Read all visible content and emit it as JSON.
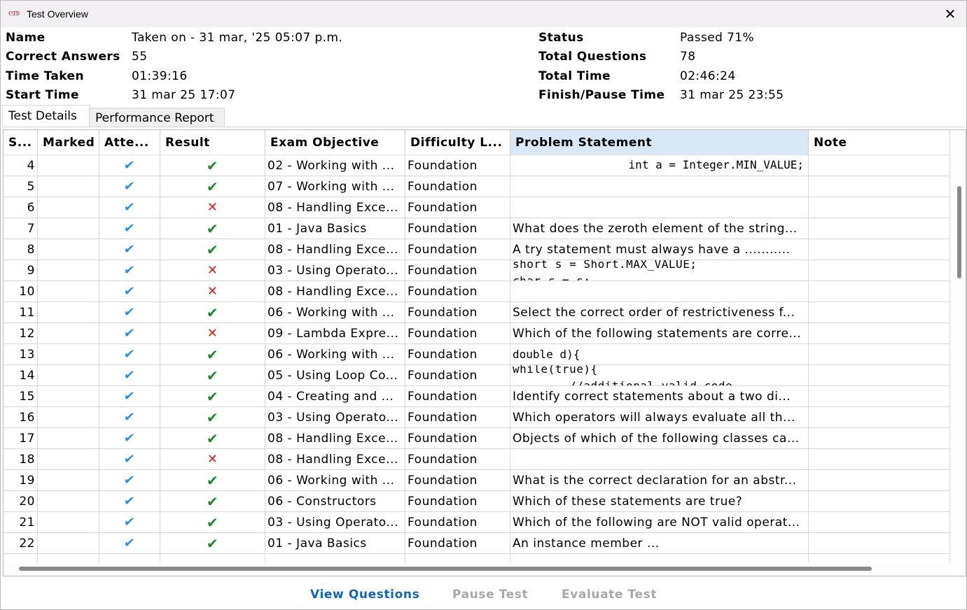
{
  "window": {
    "title": "Test Overview",
    "app_icon_text": "℮ᴛs",
    "close_glyph": "✕"
  },
  "summary": {
    "name_label": "Name",
    "name_value": "Taken on - 31 mar, '25 05:07 p.m.",
    "correct_label": "Correct Answers",
    "correct_value": "55",
    "time_taken_label": "Time Taken",
    "time_taken_value": "01:39:16",
    "start_label": "Start Time",
    "start_value": "31 mar 25 17:07",
    "status_label": "Status",
    "status_value": "Passed 71%",
    "total_q_label": "Total Questions",
    "total_q_value": "78",
    "total_time_label": "Total Time",
    "total_time_value": "02:46:24",
    "finish_label": "Finish/Pause Time",
    "finish_value": "31 mar 25 23:55"
  },
  "tabs": {
    "details": "Test Details",
    "report": "Performance Report"
  },
  "table": {
    "headers": [
      "S...",
      "Marked",
      "Atte...",
      "Result",
      "Exam Objective",
      "Difficulty L...",
      "Problem Statement",
      "Note"
    ],
    "rows": [
      {
        "sn": "4",
        "result": "ok",
        "objective": "02 - Working with ...",
        "difficulty": "Foundation",
        "problem": "int a = Integer.MIN_VALUE;",
        "ptype": "code-right"
      },
      {
        "sn": "5",
        "result": "ok",
        "objective": "07 - Working with ...",
        "difficulty": "Foundation",
        "problem": "",
        "ptype": "text"
      },
      {
        "sn": "6",
        "result": "bad",
        "objective": "08 - Handling Exce...",
        "difficulty": "Foundation",
        "problem": "",
        "ptype": "text"
      },
      {
        "sn": "7",
        "result": "ok",
        "objective": "01 - Java Basics",
        "difficulty": "Foundation",
        "problem": "What does the zeroth element of the string...",
        "ptype": "text"
      },
      {
        "sn": "8",
        "result": "ok",
        "objective": "08 - Handling Exce...",
        "difficulty": "Foundation",
        "problem": "A try statement must always have a ...........",
        "ptype": "text"
      },
      {
        "sn": "9",
        "result": "bad",
        "objective": "03 - Using Operato...",
        "difficulty": "Foundation",
        "problem": "short s = Short.MAX_VALUE;",
        "problem2": "char c = s;",
        "ptype": "code2"
      },
      {
        "sn": "10",
        "result": "bad",
        "objective": "08 - Handling Exce...",
        "difficulty": "Foundation",
        "problem": "",
        "ptype": "text"
      },
      {
        "sn": "11",
        "result": "ok",
        "objective": "06 - Working with ...",
        "difficulty": "Foundation",
        "problem": "Select the correct order of restrictiveness f...",
        "ptype": "text"
      },
      {
        "sn": "12",
        "result": "bad",
        "objective": "09 - Lambda Expre...",
        "difficulty": "Foundation",
        "problem": "Which of the following statements are corre...",
        "ptype": "text"
      },
      {
        "sn": "13",
        "result": "ok",
        "objective": "06 - Working with ...",
        "difficulty": "Foundation",
        "problem": "double d){",
        "ptype": "code-left"
      },
      {
        "sn": "14",
        "result": "ok",
        "objective": "05 - Using Loop Co...",
        "difficulty": "Foundation",
        "problem": "while(true){",
        "problem2": "        //additional valid code",
        "ptype": "code2"
      },
      {
        "sn": "15",
        "result": "ok",
        "objective": "04 - Creating and ...",
        "difficulty": "Foundation",
        "problem": "Identify correct statements about a two di...",
        "ptype": "text"
      },
      {
        "sn": "16",
        "result": "ok",
        "objective": "03 - Using Operato...",
        "difficulty": "Foundation",
        "problem": "Which operators will always evaluate all th...",
        "ptype": "text"
      },
      {
        "sn": "17",
        "result": "ok",
        "objective": "08 - Handling Exce...",
        "difficulty": "Foundation",
        "problem": "Objects of which of the following classes ca...",
        "ptype": "text"
      },
      {
        "sn": "18",
        "result": "bad",
        "objective": "08 - Handling Exce...",
        "difficulty": "Foundation",
        "problem": "",
        "ptype": "text"
      },
      {
        "sn": "19",
        "result": "ok",
        "objective": "06 - Working with ...",
        "difficulty": "Foundation",
        "problem": "What is the correct declaration for an abstr...",
        "ptype": "text"
      },
      {
        "sn": "20",
        "result": "ok",
        "objective": "06 - Constructors",
        "difficulty": "Foundation",
        "problem": "Which of these statements are true?",
        "ptype": "text"
      },
      {
        "sn": "21",
        "result": "ok",
        "objective": "03 - Using Operato...",
        "difficulty": "Foundation",
        "problem": "Which of the following are NOT valid operat...",
        "ptype": "text"
      },
      {
        "sn": "22",
        "result": "ok",
        "objective": "01 - Java Basics",
        "difficulty": "Foundation",
        "problem": "An instance member ...",
        "ptype": "text"
      }
    ]
  },
  "icons": {
    "attempted": "✔",
    "correct": "✔",
    "wrong": "✕",
    "attempted_color": "#2a8fd8",
    "correct_color": "#1e8a2e",
    "wrong_color": "#e01b1b"
  },
  "buttons": {
    "view": "View Questions",
    "pause": "Pause Test",
    "evaluate": "Evaluate Test"
  }
}
